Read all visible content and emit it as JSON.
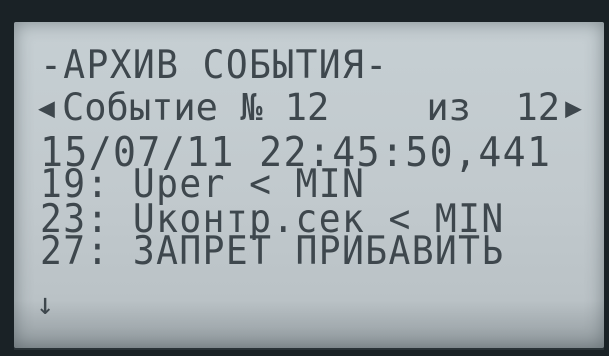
{
  "screen": {
    "title": "-АРХИВ СОБЫТИЯ-",
    "nav": {
      "prev_arrow": "◀",
      "label": "Событие № 12",
      "count": "из  12",
      "next_arrow": "▶"
    },
    "timestamp": "15/07/11 22:45:50,441",
    "events": [
      "19: Uper < MIN",
      "23: Uконтр.сек < MIN",
      "27: ЗАПРЕТ ПРИБАВИТЬ"
    ],
    "scroll_indicator": "↓"
  },
  "colors": {
    "lcd_background": "#c3cbcf",
    "lcd_text": "#3e474d",
    "bezel": "#1a2226"
  }
}
